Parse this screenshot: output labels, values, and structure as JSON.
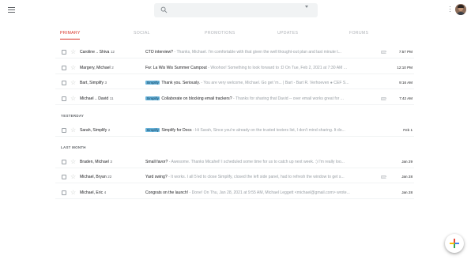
{
  "header": {
    "search_placeholder": "",
    "menu_icon": "hamburger-menu-icon",
    "search_icon": "search-icon",
    "options_icon": "more-vert-icon",
    "avatar_icon": "account-avatar-icon"
  },
  "tabs": [
    {
      "label": "PRIMARY",
      "active": true
    },
    {
      "label": "SOCIAL",
      "active": false
    },
    {
      "label": "PROMOTIONS",
      "active": false
    },
    {
      "label": "UPDATES",
      "active": false
    },
    {
      "label": "FORUMS",
      "active": false
    }
  ],
  "sections": {
    "yesterday": "YESTERDAY",
    "last_month": "LAST MONTH"
  },
  "emails": [
    {
      "sender": "Caroline .. Shiva",
      "count": "12",
      "badge": "",
      "subject": "CTO interview?",
      "snippet": " - Thanks, Michael. I'm comfortable with that given the well thought-out plan and last minute t...",
      "attachment": true,
      "date": "7:57 PM"
    },
    {
      "sender": "Margery, Michael",
      "count": "2",
      "badge": "",
      "subject": "Fw: La Wis Wis Summer Campout",
      "snippet": " - Woohoo! Something to look forward to :D On Tue, Feb 2, 2021 at 7:30 AM ...",
      "attachment": false,
      "date": "12:10 PM"
    },
    {
      "sender": "Bart, Simplify",
      "count": "3",
      "badge": "Simplify",
      "subject": "Thank you. Seriously.",
      "snippet": " - You are very welcome, Michael. Go get 'm... | Bart - Bart R. Verhoeven ● CEF S...",
      "attachment": false,
      "date": "9:16 AM"
    },
    {
      "sender": "Michael .. David",
      "count": "11",
      "badge": "Simplify",
      "subject": "Collaborate on blocking email trackers?",
      "snippet": " - Thanks for sharing that David -- over email works great for ...",
      "attachment": true,
      "date": "7:42 AM"
    },
    {
      "sender": "Sarah, Simplify",
      "count": "2",
      "badge": "Simplify",
      "subject": "Simplify for Docs",
      "snippet": " - Hi Sarah, Since you're already on the trusted testers list, I don't mind sharing. It do...",
      "attachment": false,
      "date": "Feb 1"
    },
    {
      "sender": "Braden, Michael",
      "count": "3",
      "badge": "",
      "subject": "Small favor?",
      "snippet": " - Awesome. Thanks Micahel! I scheduled some time for us to catch up next week. :) I'm really loo...",
      "attachment": false,
      "date": "Jan 29"
    },
    {
      "sender": "Michael, Bryan",
      "count": "22",
      "badge": "",
      "subject": "Yard swing?",
      "snippet": " - It works. I all 5'ed to close Simplify, closed the left side panel, had to refresh the window to get s...",
      "attachment": true,
      "date": "Jan 28"
    },
    {
      "sender": "Michael, Eric",
      "count": "4",
      "badge": "",
      "subject": "Congrats on the launch!",
      "snippet": " - Done! On Thu, Jan 28, 2021 at 9:55 AM, Michael Leggett <michael@gmail.com> wrote...",
      "attachment": false,
      "date": "Jan 28"
    }
  ],
  "compose": {
    "icon": "compose-plus-icon"
  },
  "colors": {
    "accent": "#d93025",
    "badge": "#6ab5dc",
    "compose_red": "#ea4335",
    "compose_blue": "#4285f4",
    "compose_green": "#34a853",
    "compose_yellow": "#fbbc04"
  }
}
